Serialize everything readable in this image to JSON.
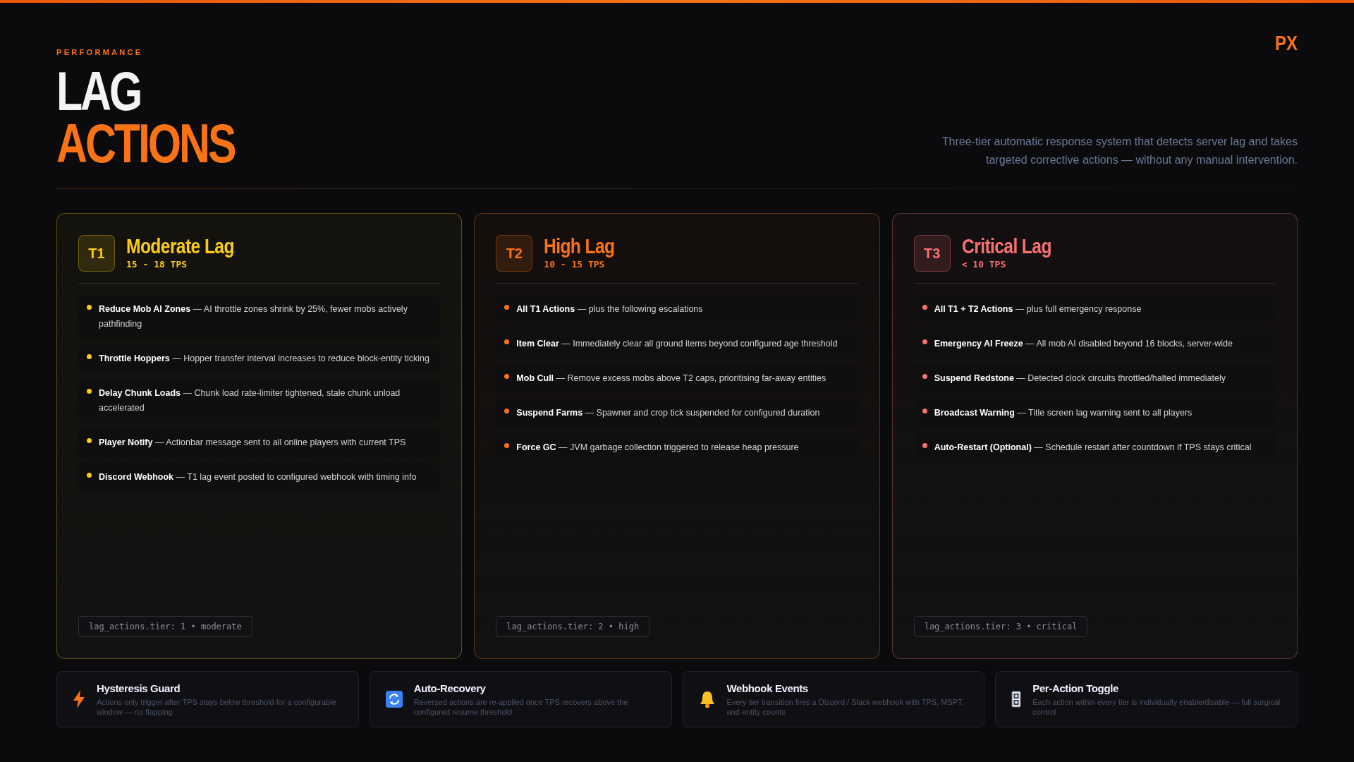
{
  "header": {
    "eyebrow": "PERFORMANCE",
    "title_line_1": "LAG",
    "title_line_2": "ACTIONS",
    "description": "Three-tier automatic response system that detects server lag and takes targeted corrective actions — without any manual intervention.",
    "logo": "PX"
  },
  "tiers": [
    {
      "badge": "T1",
      "title": "Moderate Lag",
      "range": "15 - 18 TPS",
      "color": "#facc15",
      "actions": [
        "**Reduce Mob AI Zones** — AI throttle zones shrink by 25%, fewer mobs actively pathfinding",
        "**Throttle Hoppers** — Hopper transfer interval increases to reduce block-entity ticking",
        "**Delay Chunk Loads** — Chunk load rate-limiter tightened, stale chunk unload accelerated",
        "**Player Notify** — Actionbar message sent to all online players with current TPS",
        "**Discord Webhook** — T1 lag event posted to configured webhook with timing info"
      ],
      "config": "lag_actions.tier: 1 • moderate"
    },
    {
      "badge": "T2",
      "title": "High Lag",
      "range": "10 - 15 TPS",
      "color": "#f97316",
      "actions": [
        "**All T1 Actions** — plus the following escalations",
        "**Item Clear** — Immediately clear all ground items beyond configured age threshold",
        "**Mob Cull** — Remove excess mobs above T2 caps, prioritising far-away entities",
        "**Suspend Farms** — Spawner and crop tick suspended for configured duration",
        "**Force GC** — JVM garbage collection triggered to release heap pressure"
      ],
      "config": "lag_actions.tier: 2 • high"
    },
    {
      "badge": "T3",
      "title": "Critical Lag",
      "range": "< 10 TPS",
      "color": "#f87171",
      "actions": [
        "**All T1 + T2 Actions** — plus full emergency response",
        "**Emergency AI Freeze** — All mob AI disabled beyond 16 blocks, server-wide",
        "**Suspend Redstone** — Detected clock circuits throttled/halted immediately",
        "**Broadcast Warning** — Title screen lag warning sent to all players",
        "**Auto-Restart (Optional)** — Schedule restart after countdown if TPS stays critical"
      ],
      "config": "lag_actions.tier: 3 • critical"
    }
  ],
  "features": [
    {
      "title": "Hysteresis Guard",
      "text": "Actions only trigger after TPS stays below threshold for a configurable window — no flapping"
    },
    {
      "title": "Auto-Recovery",
      "text": "Reversed actions are re-applied once TPS recovers above the configured resume threshold"
    },
    {
      "title": "Webhook Events",
      "text": "Every tier transition fires a Discord / Slack webhook with TPS, MSPT, and entity counts"
    },
    {
      "title": "Per-Action Toggle",
      "text": "Each action within every tier is individually enable/disable — full surgical control"
    }
  ]
}
